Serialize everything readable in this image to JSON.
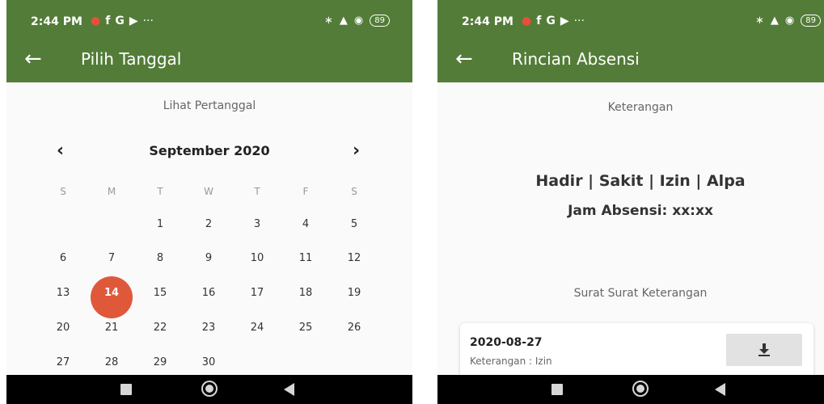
{
  "status_bar": {
    "time": "2:44 PM",
    "more": "···",
    "battery": "89",
    "icons": [
      "bluetooth-icon",
      "signal-icon",
      "wifi-icon",
      "battery-icon"
    ],
    "notification_icons": [
      "app-icon",
      "facebook-icon",
      "google-icon",
      "youtube-icon"
    ]
  },
  "colors": {
    "app_bar": "#537c38",
    "selected_day": "#e0583a",
    "nav_bar": "#000000"
  },
  "left_screen": {
    "title": "Pilih Tanggal",
    "section_label": "Lihat Pertanggal",
    "calendar": {
      "month": "September 2020",
      "prev": "‹",
      "next": "›",
      "weekdays": [
        "S",
        "M",
        "T",
        "W",
        "T",
        "F",
        "S"
      ],
      "weeks": [
        [
          "",
          "",
          "1",
          "2",
          "3",
          "4",
          "5"
        ],
        [
          "6",
          "7",
          "8",
          "9",
          "10",
          "11",
          "12"
        ],
        [
          "13",
          "14",
          "15",
          "16",
          "17",
          "18",
          "19"
        ],
        [
          "20",
          "21",
          "22",
          "23",
          "24",
          "25",
          "26"
        ],
        [
          "27",
          "28",
          "29",
          "30",
          "",
          "",
          ""
        ]
      ],
      "selected": "14"
    }
  },
  "right_screen": {
    "title": "Rincian Absensi",
    "section_label": "Keterangan",
    "status_options": "Hadir | Sakit | Izin | Alpa",
    "time_label": "Jam Absensi: xx:xx",
    "letters_label": "Surat Surat Keterangan",
    "card": {
      "date": "2020-08-27",
      "description": "Keterangan : Izin"
    }
  }
}
